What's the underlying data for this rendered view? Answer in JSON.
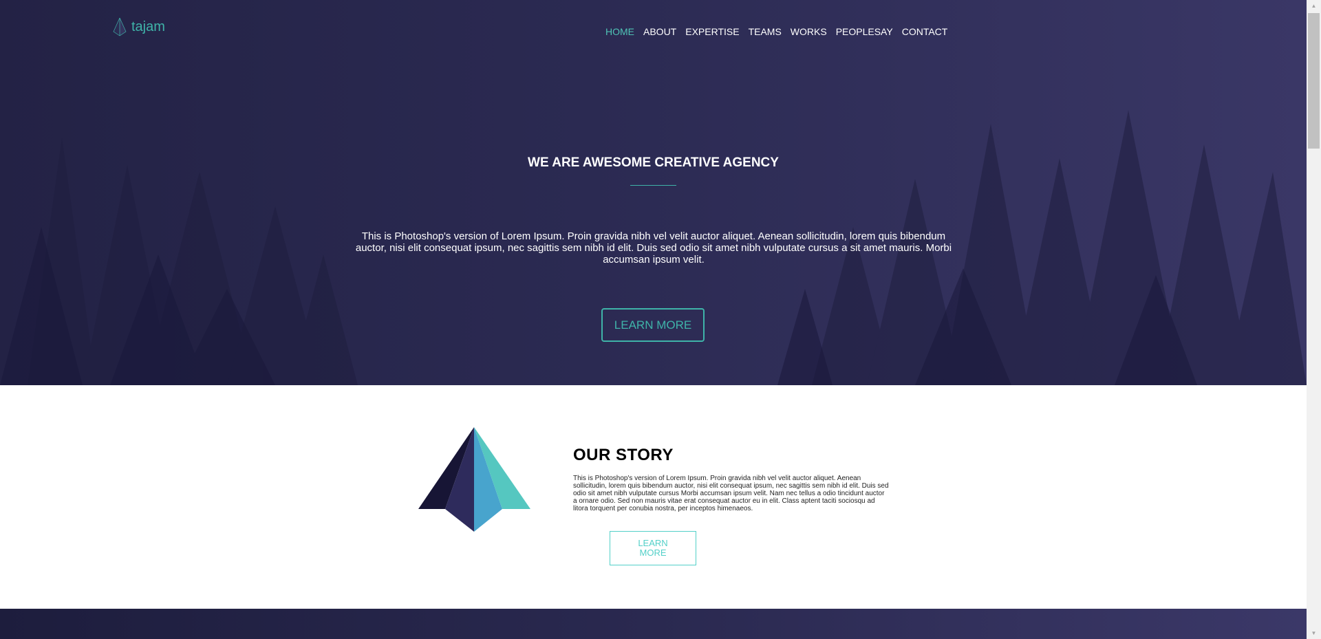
{
  "header": {
    "logo_text": "tajam",
    "logo_icon": "pyramid-logo-icon",
    "nav": [
      {
        "label": "HOME",
        "active": true
      },
      {
        "label": "ABOUT"
      },
      {
        "label": "EXPERTISE"
      },
      {
        "label": "TEAMS"
      },
      {
        "label": "WORKS"
      },
      {
        "label": "PEOPLESAY"
      },
      {
        "label": "CONTACT"
      }
    ]
  },
  "hero": {
    "title": "WE ARE AWESOME CREATIVE AGENCY",
    "text": "This is Photoshop's version of Lorem Ipsum. Proin gravida nibh vel velit auctor aliquet. Aenean sollicitudin, lorem quis bibendum auctor, nisi elit consequat ipsum, nec sagittis sem nibh id elit. Duis sed odio sit amet nibh vulputate cursus a sit amet mauris. Morbi accumsan ipsum velit.",
    "button_label": "LEARN MORE"
  },
  "story": {
    "title": "OUR STORY",
    "text": "This is Photoshop's version of Lorem Ipsum. Proin gravida nibh vel velit auctor aliquet. Aenean sollicitudin, lorem quis bibendum auctor, nisi elit consequat ipsum, nec sagittis sem nibh id elit. Duis sed odio sit amet nibh vulputate cursus Morbi accumsan ipsum velit. Nam nec tellus a odio tincidunt auctor a ornare odio. Sed non mauris vitae erat consequat auctor eu in elit. Class aptent taciti sociosqu ad litora torquent per conubia nostra, per inceptos himenaeos.",
    "button_label": "LEARN MORE",
    "icon": "pyramid-icon"
  },
  "colors": {
    "accent": "#3fb4a9",
    "hero_bg": "#2b2a52"
  }
}
